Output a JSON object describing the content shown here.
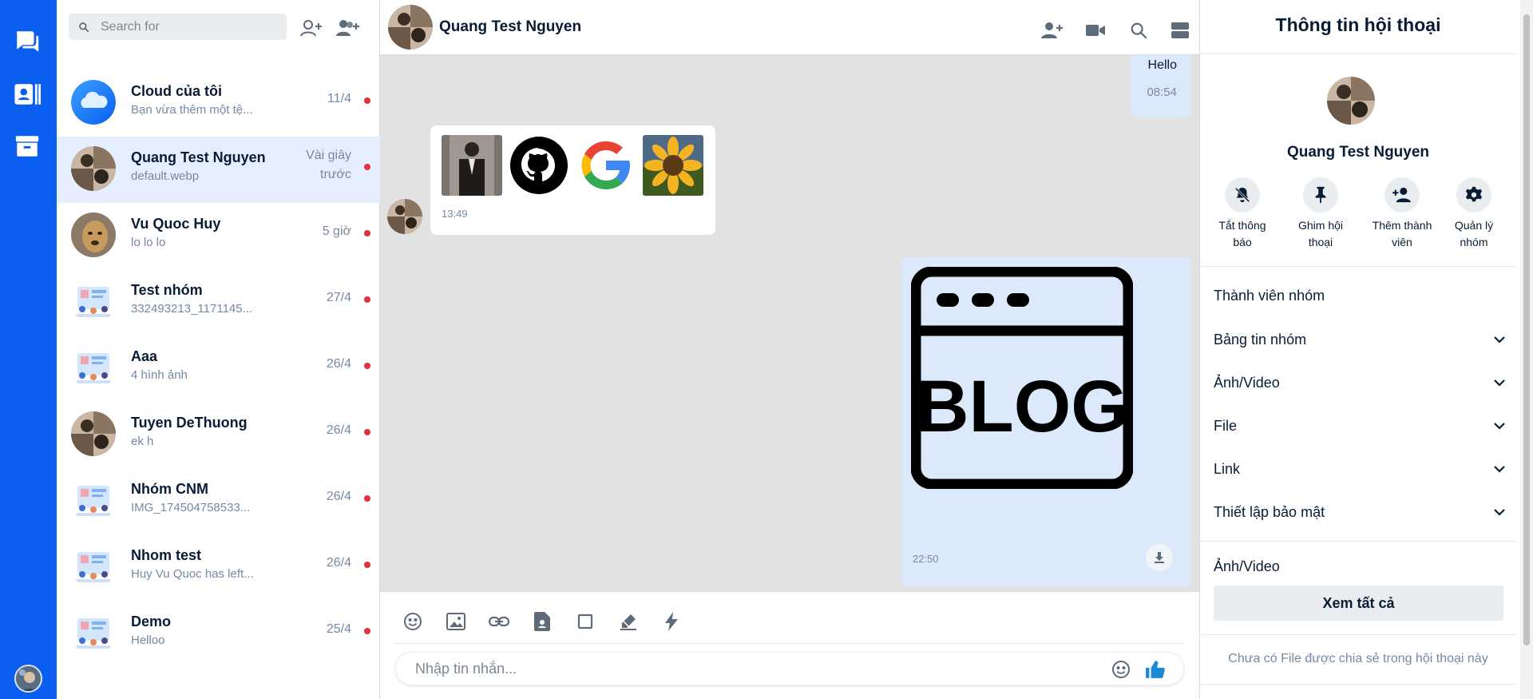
{
  "search": {
    "placeholder": "Search for"
  },
  "conversations": [
    {
      "name": "Cloud của tôi",
      "preview": "Bạn vừa thêm một tệ...",
      "time": "11/4"
    },
    {
      "name": "Quang Test Nguyen",
      "preview": "default.webp",
      "time_line1": "Vài giây",
      "time_line2": "trước"
    },
    {
      "name": "Vu Quoc Huy",
      "preview": "lo lo lo",
      "time": "5 giờ"
    },
    {
      "name": "Test nhóm",
      "preview": "332493213_1171145...",
      "time": "27/4"
    },
    {
      "name": "Aaa",
      "preview": "4 hình ảnh",
      "time": "26/4"
    },
    {
      "name": "Tuyen DeThuong",
      "preview": "ek h",
      "time": "26/4"
    },
    {
      "name": "Nhóm CNM",
      "preview": "IMG_174504758533...",
      "time": "26/4"
    },
    {
      "name": "Nhom test",
      "preview": "Huy Vu Quoc has left...",
      "time": "26/4"
    },
    {
      "name": "Demo",
      "preview": "Helloo",
      "time": "25/4"
    }
  ],
  "chat": {
    "title": "Quang Test Nguyen",
    "messages": {
      "hello_text": "Hello",
      "hello_time": "08:54",
      "images_time": "13:49",
      "blog_text": "BLOG",
      "blog_time": "22:50"
    },
    "input_placeholder": "Nhập tin nhắn..."
  },
  "info": {
    "title": "Thông tin hội thoại",
    "name": "Quang Test Nguyen",
    "actions": [
      {
        "line1": "Tắt thông",
        "line2": "báo"
      },
      {
        "line1": "Ghim hội",
        "line2": "thoại"
      },
      {
        "line1": "Thêm thành",
        "line2": "viên"
      },
      {
        "line1": "Quản lý",
        "line2": "nhóm"
      }
    ],
    "sections": [
      "Thành viên nhóm",
      "Bảng tin nhóm",
      "Ảnh/Video",
      "File",
      "Link",
      "Thiết lập bảo mật"
    ],
    "media_heading": "Ảnh/Video",
    "see_all": "Xem tất cả",
    "empty_files": "Chưa có File được chia sẻ trong hội thoại này"
  },
  "colors": {
    "nav": "#0a5ff0",
    "active_row": "#e5efff",
    "unread_dot": "#e0313c",
    "my_bubble": "#dbe9fb",
    "chat_bg": "#e2e2e2"
  }
}
